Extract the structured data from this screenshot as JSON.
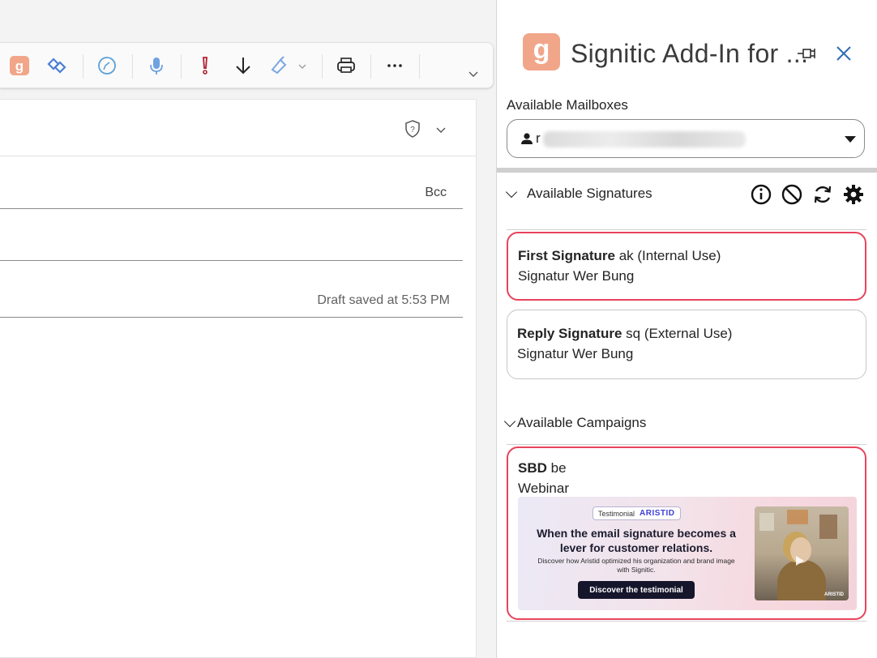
{
  "compose": {
    "bcc_label": "Bcc",
    "draft_status": "Draft saved at 5:53 PM"
  },
  "toolbar": {
    "buttons": [
      "signitic-icon",
      "loop-icon",
      "copilot-icon",
      "dictate-icon",
      "importance-icon",
      "low-importance-icon",
      "sensitivity-icon",
      "print-icon",
      "more-icon",
      "expand-icon"
    ]
  },
  "panel": {
    "title": "Signitic Add-In for ...",
    "logo_letter": "g",
    "mailboxes": {
      "label": "Available Mailboxes",
      "selected_value": "r"
    },
    "signatures": {
      "header": "Available Signatures",
      "items": [
        {
          "name": "First Signature",
          "suffix": " ak (Internal Use)",
          "subtitle": "Signatur Wer Bung"
        },
        {
          "name": "Reply Signature",
          "suffix": " sq (External Use)",
          "subtitle": "Signatur Wer Bung"
        }
      ]
    },
    "campaigns": {
      "header": "Available Campaigns",
      "items": [
        {
          "name": "SBD",
          "suffix": " be",
          "subtitle": "Webinar",
          "banner": {
            "tag_label": "Testimonial",
            "tag_brand": "ARISTID",
            "headline": "When the email signature becomes a lever for customer relations.",
            "subtext": "Discover how Aristid optimized his organization and brand image with Signitic.",
            "button_label": "Discover the testimonial",
            "photo_mark": "ARISTID"
          }
        }
      ]
    }
  },
  "colors": {
    "accent_selected": "#e8435c",
    "logo_bg": "#f1a68a",
    "close_icon": "#2f6db5"
  }
}
